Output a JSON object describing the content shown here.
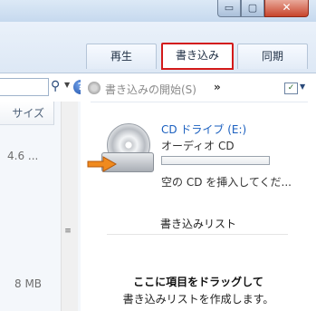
{
  "window": {
    "controls": {
      "minimize": "▭",
      "maximize": "▢",
      "close": "✕"
    }
  },
  "tabs": [
    {
      "label": "再生",
      "selected": false
    },
    {
      "label": "書き込み",
      "selected": true
    },
    {
      "label": "同期",
      "selected": false
    }
  ],
  "left": {
    "column_header": "サイズ",
    "sizes": [
      "4.6 ...",
      "8 MB"
    ]
  },
  "command_bar": {
    "burn_start": "書き込みの開始(S)",
    "more": "»"
  },
  "drive": {
    "name": "CD ドライブ (E:)",
    "media": "オーディオ CD",
    "hint": "空の CD を挿入してくだ..."
  },
  "burn_list": {
    "title": "書き込みリスト",
    "drop_title": "ここに項目をドラッグして",
    "drop_sub": "書き込みリストを作成します。"
  },
  "colors": {
    "highlight": "#d31a1a",
    "link": "#1a5fbf"
  }
}
